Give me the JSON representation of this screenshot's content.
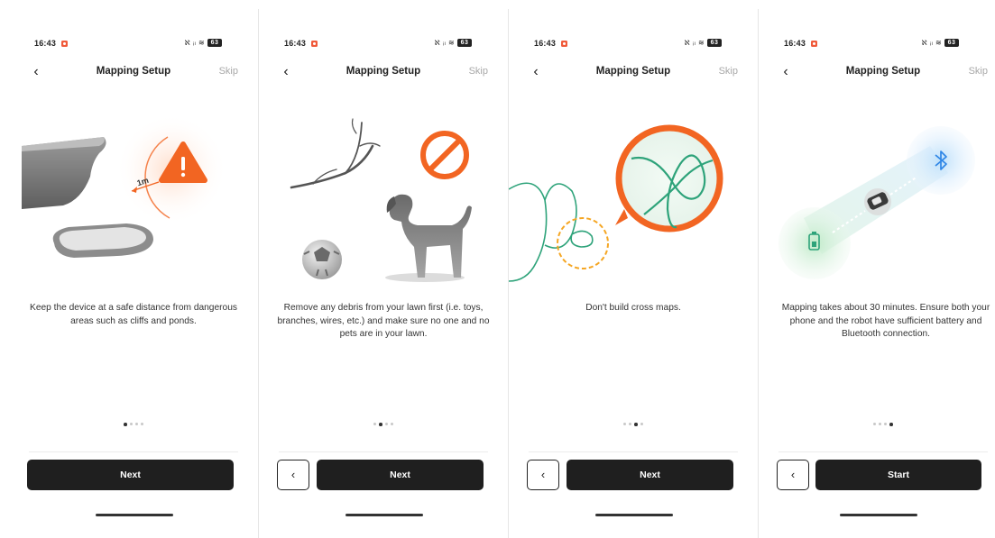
{
  "screens": [
    {
      "status": {
        "time": "16:43",
        "icons": "ℵ ᵢₗ ≋",
        "battery": "63"
      },
      "nav": {
        "back": "‹",
        "title": "Mapping Setup",
        "skip": "Skip"
      },
      "illustration": {
        "label": "1m",
        "icons": [
          "cliff",
          "pond",
          "warning-icon"
        ]
      },
      "description": "Keep the device at a safe distance from dangerous areas such as cliffs and ponds.",
      "page_index": 1,
      "page_count": 4,
      "primary_button": "Next",
      "has_back_button": false
    },
    {
      "status": {
        "time": "16:43",
        "icons": "ℵ ᵢₗ ≋",
        "battery": "63"
      },
      "nav": {
        "back": "‹",
        "title": "Mapping Setup",
        "skip": "Skip"
      },
      "illustration": {
        "icons": [
          "branch",
          "ball",
          "dog",
          "prohibited-icon"
        ]
      },
      "description": "Remove any debris from your lawn first (i.e. toys, branches, wires, etc.) and make sure no one and no pets are in your lawn.",
      "page_index": 2,
      "page_count": 4,
      "primary_button": "Next",
      "back_button": "‹",
      "has_back_button": true
    },
    {
      "status": {
        "time": "16:43",
        "icons": "ℵ ᵢₗ ≋",
        "battery": "63"
      },
      "nav": {
        "back": "‹",
        "title": "Mapping Setup",
        "skip": "Skip"
      },
      "illustration": {
        "icons": [
          "path-line",
          "crossing-loop"
        ]
      },
      "description": "Don't build cross maps.",
      "page_index": 3,
      "page_count": 4,
      "primary_button": "Next",
      "back_button": "‹",
      "has_back_button": true
    },
    {
      "status": {
        "time": "16:43",
        "icons": "ℵ ᵢₗ ≋",
        "battery": "63"
      },
      "nav": {
        "back": "‹",
        "title": "Mapping Setup",
        "skip": "Skip"
      },
      "illustration": {
        "icons": [
          "battery-icon",
          "robot-mower",
          "bluetooth-icon"
        ]
      },
      "description": "Mapping takes about 30 minutes. Ensure both your phone and the robot have sufficient battery and Bluetooth connection.",
      "page_index": 4,
      "page_count": 4,
      "primary_button": "Start",
      "back_button": "‹",
      "has_back_button": true
    }
  ],
  "colors": {
    "accent_orange": "#f26522",
    "green_line": "#2ea37a",
    "button_dark": "#1f1f1f",
    "skip_gray": "#a8a8a8"
  }
}
